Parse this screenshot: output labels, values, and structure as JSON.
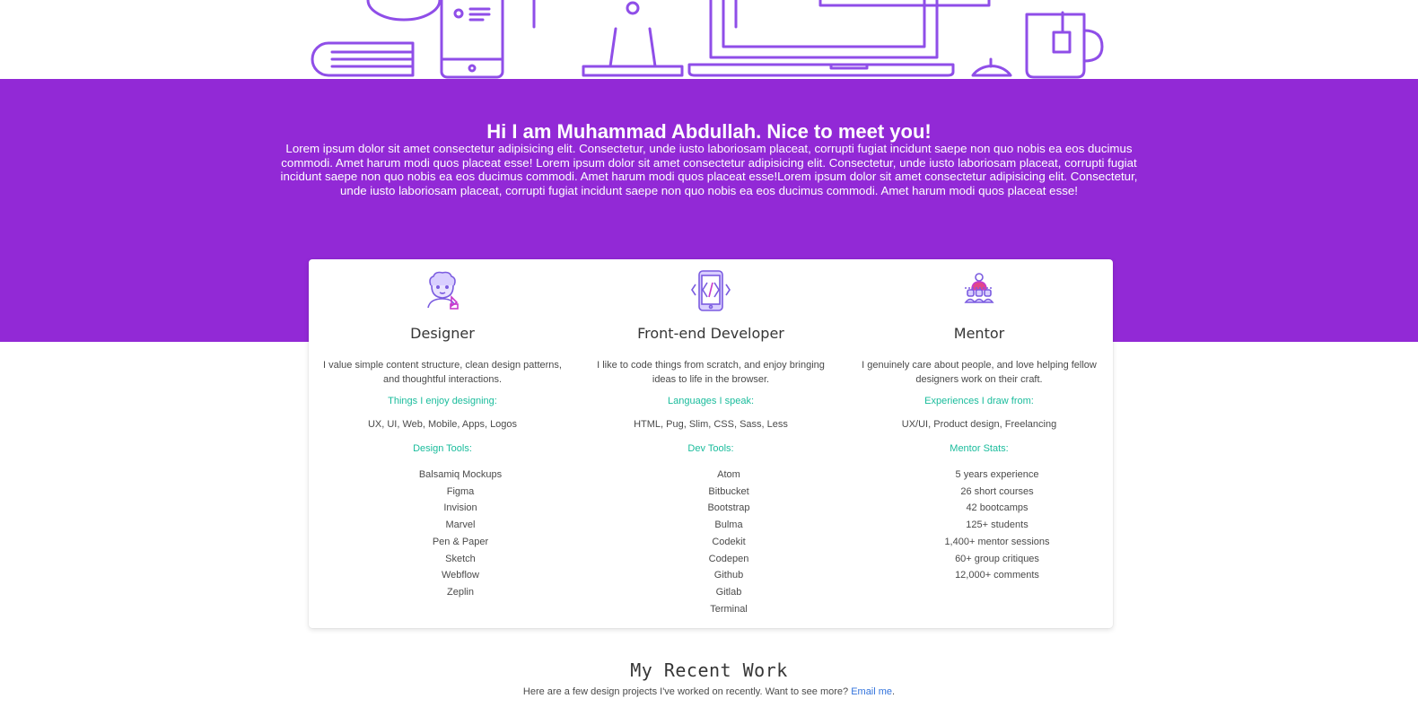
{
  "hero": {
    "title": "Hi I am Muhammad Abdullah. Nice to meet you!",
    "text": "Lorem ipsum dolor sit amet consectetur adipisicing elit. Consectetur, unde iusto laboriosam placeat, corrupti fugiat incidunt saepe non quo nobis ea eos ducimus commodi. Amet harum modi quos placeat esse! Lorem ipsum dolor sit amet consectetur adipisicing elit. Consectetur, unde iusto laboriosam placeat, corrupti fugiat incidunt saepe non quo nobis ea eos ducimus commodi. Amet harum modi quos placeat esse!Lorem ipsum dolor sit amet consectetur adipisicing elit. Consectetur, unde iusto laboriosam placeat, corrupti fugiat incidunt saepe non quo nobis ea eos ducimus commodi. Amet harum modi quos placeat esse!",
    "bg_color": "#9229d6",
    "illustration_icon": "workspace-illustration-icon"
  },
  "skills": [
    {
      "icon": "designer-icon",
      "title": "Designer",
      "description": "I value simple content structure, clean design patterns, and thoughtful interactions.",
      "label1": "Things I enjoy designing:",
      "skills": "UX, UI, Web, Mobile, Apps, Logos",
      "label2": "Design Tools:",
      "items": [
        "Balsamiq Mockups",
        "Figma",
        "Invision",
        "Marvel",
        "Pen & Paper",
        "Sketch",
        "Webflow",
        "Zeplin"
      ]
    },
    {
      "icon": "phone-code-icon",
      "title": "Front-end Developer",
      "description": "I like to code things from scratch, and enjoy bringing ideas to life in the browser.",
      "label1": "Languages I speak:",
      "skills": "HTML, Pug, Slim, CSS, Sass, Less",
      "label2": "Dev Tools:",
      "items": [
        "Atom",
        "Bitbucket",
        "Bootstrap",
        "Bulma",
        "Codekit",
        "Codepen",
        "Github",
        "Gitlab",
        "Terminal"
      ]
    },
    {
      "icon": "mentor-icon",
      "title": "Mentor",
      "description": "I genuinely care about people, and love helping fellow designers work on their craft.",
      "label1": "Experiences I draw from:",
      "skills": "UX/UI, Product design, Freelancing",
      "label2": "Mentor Stats:",
      "items": [
        "5 years experience",
        "26 short courses",
        "42 bootcamps",
        "125+ students",
        "1,400+ mentor sessions",
        "60+ group critiques",
        "12,000+ comments"
      ]
    }
  ],
  "recent": {
    "title": "My Recent Work",
    "text": "Here are a few design projects I've worked on recently. Want to see more?",
    "link": "Email me",
    "trail": "."
  }
}
